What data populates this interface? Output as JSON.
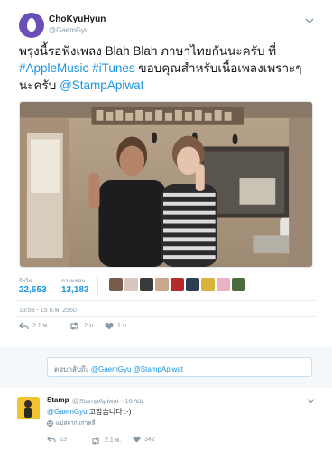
{
  "author": {
    "name": "ChoKyuHyun",
    "handle": "@GaemGyu",
    "avatar_color": "#6a4fb8"
  },
  "tweet": {
    "text_part1": "พรุ่งนี้รอฟังเพลง Blah Blah ภาษาไทยกันนะครับ ที่",
    "hashtag1": "#AppleMusic",
    "space": " ",
    "hashtag2": "#iTunes",
    "text_part2": " ขอบคุณสำหรับเนื้อเพลงเพราะๆ นะครับ ",
    "mention": "@StampApiwat"
  },
  "stats": {
    "retweets_label": "รีทวีต",
    "retweets": "22,653",
    "likes_label": "ความชอบ",
    "likes": "13,183",
    "liker_colors": [
      "#7a5c4e",
      "#d8c7bf",
      "#3a3a3a",
      "#c9a88d",
      "#b52a2a",
      "#2c3e50",
      "#d9b23a",
      "#e8b4c4",
      "#4c6b3a"
    ]
  },
  "timestamp": "13:53 - 15 ก.พ. 2560",
  "actions": {
    "replies": "2.1 พ.",
    "retweets": "2 ม.",
    "likes": "1 ม."
  },
  "reply_box": {
    "prefix": "ตอบกลับถึง ",
    "mentions": "@GaemGyu @StampApiwat"
  },
  "reply": {
    "name": "Stamp",
    "handle": "@StampApiwat · 16 ชม.",
    "mention": "@GaemGyu",
    "text": " 고맙습니다 :-)",
    "translate": "แปลจาก เกาหลี",
    "replies": "23",
    "retweets": "2.1 พ.",
    "likes": "342"
  },
  "colors": {
    "link": "#1b95e0",
    "secondary": "#8899a6"
  }
}
